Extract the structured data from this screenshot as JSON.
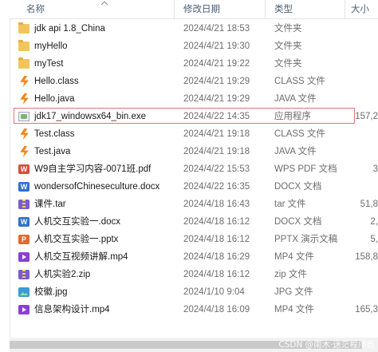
{
  "columns": {
    "name": "名称",
    "date": "修改日期",
    "type": "类型",
    "size": "大小"
  },
  "rows": [
    {
      "name": "jdk api 1.8_China",
      "date": "2024/4/21 18:53",
      "type": "文件夹",
      "size": "",
      "icon": "folder-icon",
      "selected": false
    },
    {
      "name": "myHello",
      "date": "2024/4/21 19:30",
      "type": "文件夹",
      "size": "",
      "icon": "folder-icon",
      "selected": false
    },
    {
      "name": "myTest",
      "date": "2024/4/21 19:22",
      "type": "文件夹",
      "size": "",
      "icon": "folder-icon",
      "selected": false
    },
    {
      "name": "Hello.class",
      "date": "2024/4/21 19:29",
      "type": "CLASS 文件",
      "size": "",
      "icon": "java-class-icon",
      "selected": false
    },
    {
      "name": "Hello.java",
      "date": "2024/4/21 19:29",
      "type": "JAVA 文件",
      "size": "",
      "icon": "java-file-icon",
      "selected": false
    },
    {
      "name": "jdk17_windowsx64_bin.exe",
      "date": "2024/4/22 14:35",
      "type": "应用程序",
      "size": "157,2",
      "icon": "installer-exe-icon",
      "selected": true
    },
    {
      "name": "Test.class",
      "date": "2024/4/21 19:18",
      "type": "CLASS 文件",
      "size": "",
      "icon": "java-class-icon",
      "selected": false
    },
    {
      "name": "Test.java",
      "date": "2024/4/21 19:18",
      "type": "JAVA 文件",
      "size": "",
      "icon": "java-file-icon",
      "selected": false
    },
    {
      "name": "W9自主学习内容-0071班.pdf",
      "date": "2024/4/22 15:53",
      "type": "WPS PDF 文档",
      "size": "3",
      "icon": "pdf-file-icon",
      "selected": false
    },
    {
      "name": "wondersofChineseculture.docx",
      "date": "2024/4/22 16:35",
      "type": "DOCX 文档",
      "size": "",
      "icon": "word-docx-icon",
      "selected": false
    },
    {
      "name": "课件.tar",
      "date": "2024/4/18 16:43",
      "type": "tar 文件",
      "size": "51,8",
      "icon": "archive-icon",
      "selected": false
    },
    {
      "name": "人机交互实验一.docx",
      "date": "2024/4/18 16:12",
      "type": "DOCX 文档",
      "size": "2,",
      "icon": "word-docx-icon",
      "selected": false
    },
    {
      "name": "人机交互实验一.pptx",
      "date": "2024/4/18 16:12",
      "type": "PPTX 演示文稿",
      "size": "5,",
      "icon": "pptx-file-icon",
      "selected": false
    },
    {
      "name": "人机交互视频讲解.mp4",
      "date": "2024/4/18 16:29",
      "type": "MP4 文件",
      "size": "158,8",
      "icon": "video-file-icon",
      "selected": false
    },
    {
      "name": "人机实验2.zip",
      "date": "2024/4/18 16:12",
      "type": "zip 文件",
      "size": "",
      "icon": "archive-icon",
      "selected": false
    },
    {
      "name": "校徽.jpg",
      "date": "2024/1/10 9:04",
      "type": "JPG 文件",
      "size": "",
      "icon": "image-file-icon",
      "selected": false
    },
    {
      "name": "信息架构设计.mp4",
      "date": "2024/4/18 16:09",
      "type": "MP4 文件",
      "size": "165,3",
      "icon": "video-file-icon",
      "selected": false
    }
  ],
  "watermark": "CSDN @南木·迷茫程序员",
  "colors": {
    "header_text": "#4c607a",
    "selection_border": "#e07676",
    "folder": "#f2c55c",
    "java": "#f08519"
  }
}
